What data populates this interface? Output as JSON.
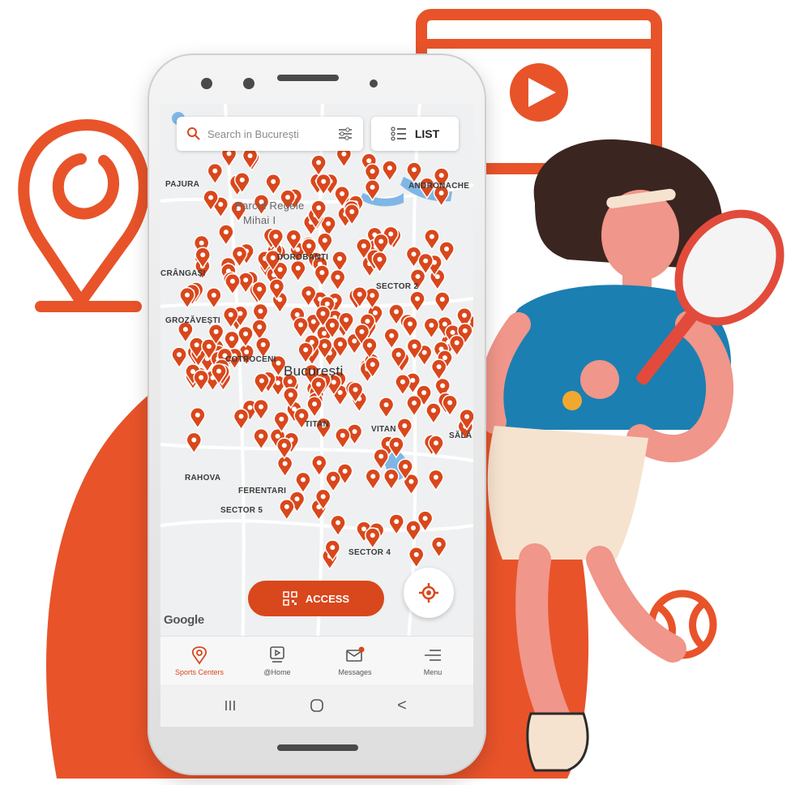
{
  "colors": {
    "brand_orange": "#E8532A",
    "pin": "#D9471C",
    "map_bg": "#EEF0F1",
    "water": "#7FB6E6"
  },
  "search": {
    "placeholder": "Search in București",
    "icon": "search-icon",
    "filter_icon": "filter-sliders-icon"
  },
  "list_button": {
    "label": "LIST",
    "icon": "list-icon"
  },
  "map": {
    "city": "București",
    "areas": [
      "PAJURA",
      "Parcul Regele",
      "Mihai I",
      "ANDRONACHE",
      "DOROBANȚI",
      "CRÂNGAȘI",
      "SECTOR 2",
      "GROZĂVEȘTI",
      "COTROCENI",
      "VITAN",
      "SĂLĂ",
      "RAHOVA",
      "FERENTARI",
      "SECTOR 5",
      "SECTOR 4",
      "TITAN"
    ],
    "attribution": "Google"
  },
  "access_button": {
    "label": "ACCESS",
    "icon": "qr-code-icon"
  },
  "locate_button": {
    "icon": "crosshair-locate-icon"
  },
  "tabs": [
    {
      "label": "Sports Centers",
      "icon": "map-pin-icon",
      "active": true
    },
    {
      "label": "@Home",
      "icon": "video-player-icon",
      "active": false
    },
    {
      "label": "Messages",
      "icon": "envelope-icon",
      "active": false,
      "badge": true
    },
    {
      "label": "Menu",
      "icon": "menu-lines-icon",
      "active": false
    }
  ],
  "system_nav": [
    {
      "icon": "recent-apps-icon"
    },
    {
      "icon": "home-circle-icon"
    },
    {
      "icon": "back-chevron-icon",
      "glyph": "<"
    }
  ]
}
